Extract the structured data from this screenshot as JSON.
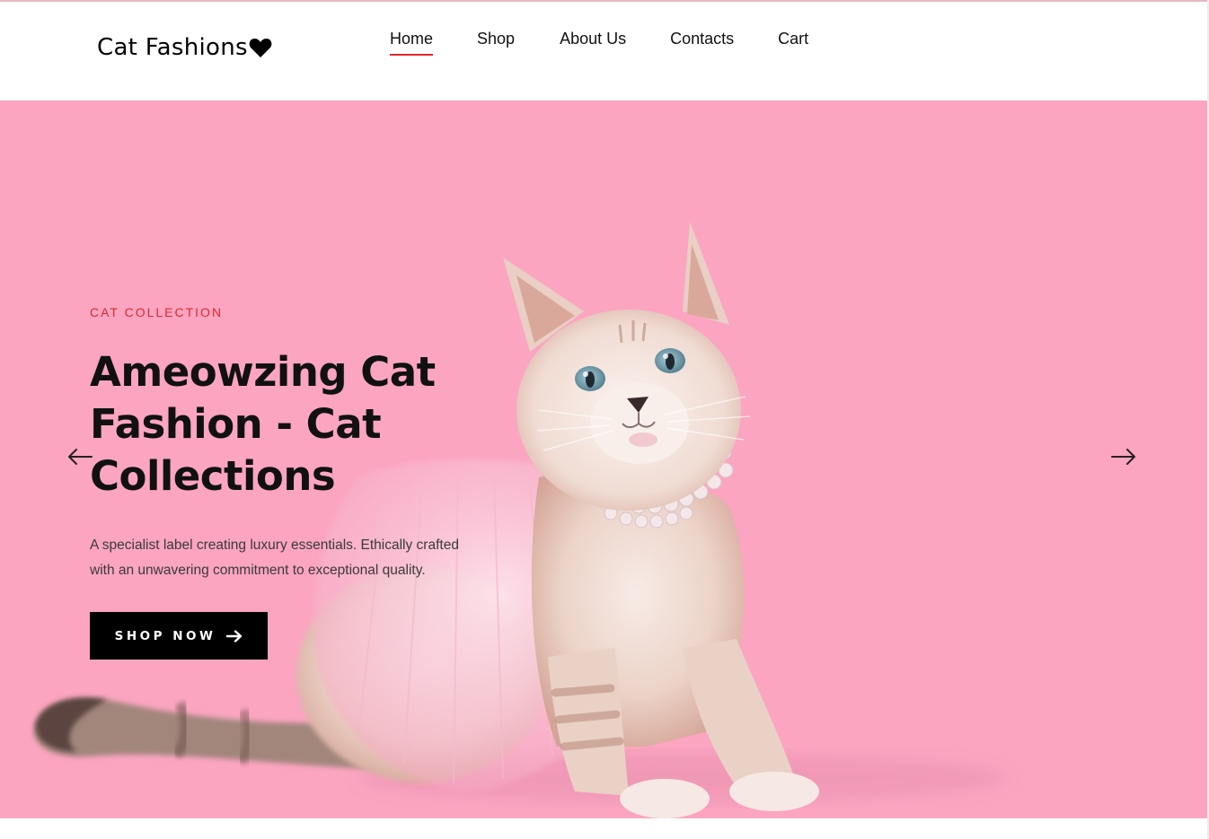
{
  "header": {
    "logo_text": "Cat Fashions",
    "logo_icon": "heart-icon"
  },
  "nav": {
    "items": [
      {
        "label": "Home",
        "active": true
      },
      {
        "label": "Shop",
        "active": false
      },
      {
        "label": "About Us",
        "active": false
      },
      {
        "label": "Contacts",
        "active": false
      },
      {
        "label": "Cart",
        "active": false
      }
    ]
  },
  "hero": {
    "eyebrow": "CAT COLLECTION",
    "headline_lines": [
      "Ameowzing Cat",
      "Fashion - Cat",
      "Collections"
    ],
    "description_lines": [
      "A specialist label creating luxury essentials. Ethically crafted",
      "with an unwavering commitment to exceptional quality."
    ],
    "cta_label": "SHOP NOW",
    "cta_icon": "arrow-right-icon",
    "prev_icon": "arrow-left-icon",
    "next_icon": "arrow-right-icon",
    "image": "kitten-in-pink-tutu-and-pearl-necklace"
  },
  "colors": {
    "hero_background": "#fba5c1",
    "accent_red": "#e0282e",
    "button_black": "#000000"
  }
}
